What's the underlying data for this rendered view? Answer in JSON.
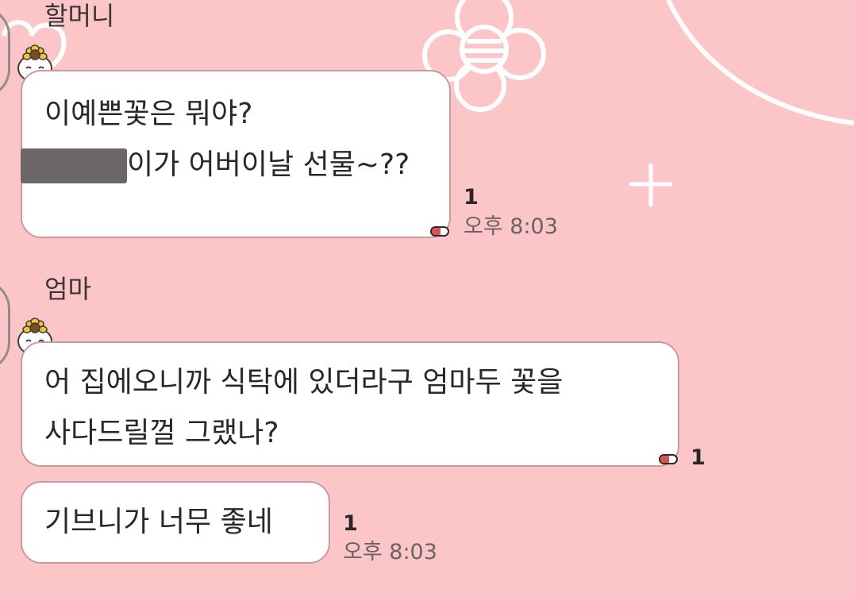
{
  "messages": [
    {
      "sender": "할머니",
      "bubbles": [
        {
          "lines": [
            "이예쁜꽃은 뭐야?",
            "이가 어버이날 선물~??"
          ],
          "unread": "1",
          "time": "오후 8:03"
        }
      ]
    },
    {
      "sender": "엄마",
      "bubbles": [
        {
          "lines": [
            "어 집에오니까 식탁에 있더라구 엄마두  꽃을",
            "사다드릴껄 그랬나?"
          ],
          "unread": "1"
        },
        {
          "lines": [
            "기브니가 너무 좋네"
          ],
          "unread": "1",
          "time": "오후 8:03"
        }
      ]
    }
  ],
  "colors": {
    "background": "#fcc6c8",
    "bubble": "#ffffff",
    "bubble_border": "#c99aa0",
    "read_indicator": "#e0504f",
    "decoration": "#ffffff"
  },
  "icons": {
    "avatar": "sunflower-face-emoticon",
    "read_indicator": "pill-icon",
    "decorations": [
      "heart-outline",
      "flower",
      "circle-outline",
      "plus-sparkle"
    ]
  }
}
